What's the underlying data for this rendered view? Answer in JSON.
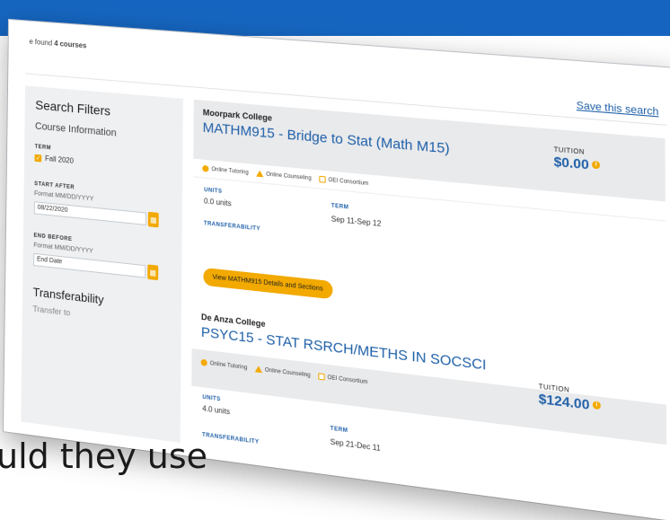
{
  "results": {
    "found_prefix": "e found",
    "found_count": "4 courses",
    "save_search_label": "Save this search"
  },
  "filters": {
    "title": "Search Filters",
    "section": "Course Information",
    "term_label": "TERM",
    "term_option": "Fall 2020",
    "term_checked": true,
    "start_after_label": "START AFTER",
    "start_after_format": "Format MM/DD/YYYY",
    "start_after_value": "08/22/2020",
    "end_before_label": "END BEFORE",
    "end_before_format": "Format MM/DD/YYYY",
    "end_before_placeholder": "End Date",
    "transferability_title": "Transferability",
    "transfer_to_label": "Transfer to"
  },
  "courses": [
    {
      "college": "Moorpark College",
      "title": "MATHM915 - Bridge to Stat (Math M15)",
      "tuition_label": "TUITION",
      "tuition": "$0.00",
      "services": [
        "Online Tutoring",
        "Online Counseling",
        "OEI Consortium"
      ],
      "units_label": "UNITS",
      "units": "0.0 units",
      "term_label": "TERM",
      "term": "Sep 11-Sep 12",
      "transferability_label": "TRANSFERABILITY",
      "details_button": "View MATHM915 Details and Sections"
    },
    {
      "college": "De Anza College",
      "title": "PSYC15 - STAT RSRCH/METHS IN SOCSCI",
      "tuition_label": "TUITION",
      "tuition": "$124.00",
      "services": [
        "Online Tutoring",
        "Online Counseling",
        "OEI Consortium"
      ],
      "units_label": "UNITS",
      "units": "4.0 units",
      "term_label": "TERM",
      "term": "Sep 21-Dec 11",
      "transferability_label": "TRANSFERABILITY"
    }
  ],
  "caption": "uld they use",
  "colors": {
    "header": "#1565c0",
    "accent": "#f2a900",
    "link": "#1e5fa8"
  }
}
